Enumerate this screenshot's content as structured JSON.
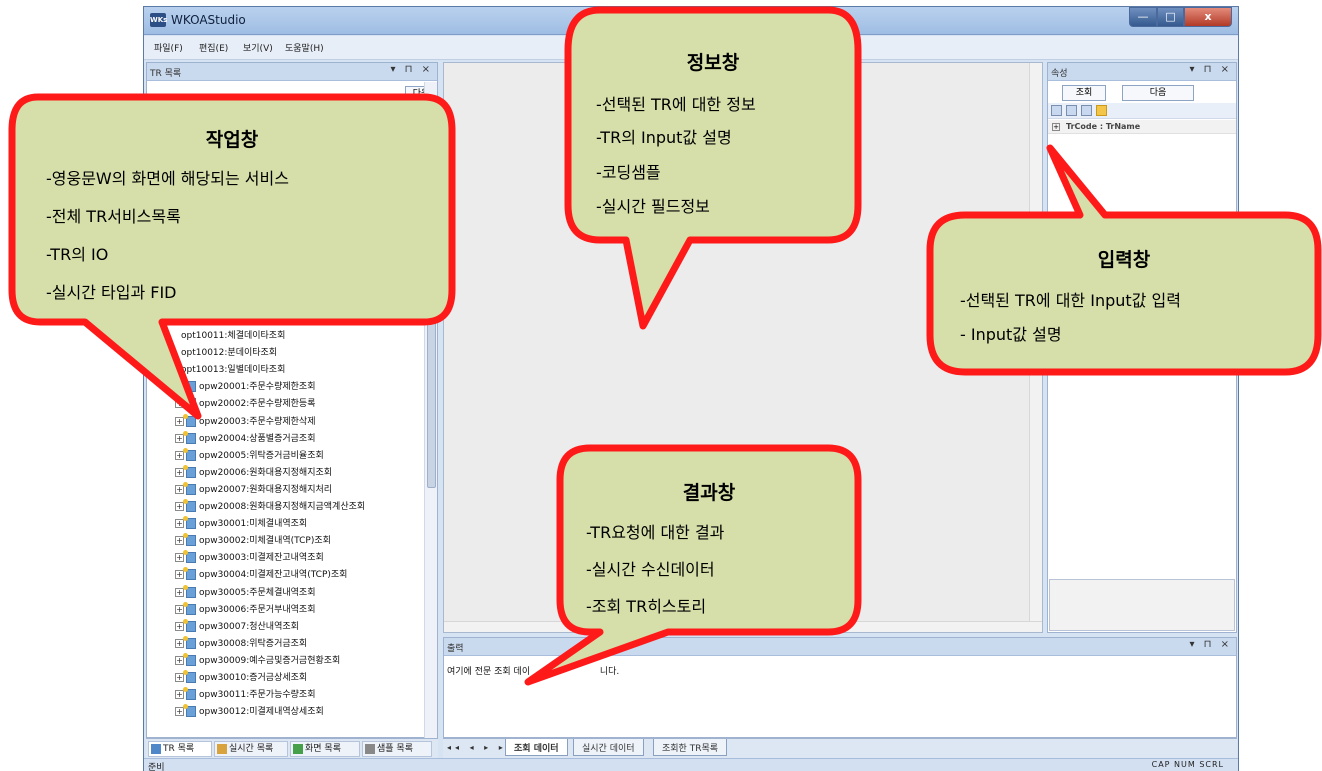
{
  "window": {
    "title": "WKOAStudio",
    "icon_text": "WKs",
    "min": "—",
    "max": "□",
    "close": "x"
  },
  "menu": {
    "items": [
      "파일(F)",
      "편집(E)",
      "보기(V)",
      "도움말(H)"
    ]
  },
  "left_pane": {
    "title": "TR 목록",
    "next_button": "다음",
    "tree_items": [
      "opt10011:체결데이타조회",
      "opt10012:분데이타조회",
      "opt10013:일별데이타조회",
      "opw20001:주문수량제한조회",
      "opw20002:주문수량제한등록",
      "opw20003:주문수량제한삭제",
      "opw20004:상품별증거금조회",
      "opw20005:위탁증거금비율조회",
      "opw20006:원화대용지정해지조회",
      "opw20007:원화대용지정해지처리",
      "opw20008:원화대용지정해지금액계산조회",
      "opw30001:미체결내역조회",
      "opw30002:미체결내역(TCP)조회",
      "opw30003:미결제잔고내역조회",
      "opw30004:미결제잔고내역(TCP)조회",
      "opw30005:주문체결내역조회",
      "opw30006:주문거부내역조회",
      "opw30007:청산내역조회",
      "opw30008:위탁증거금조회",
      "opw30009:예수금및증거금현황조회",
      "opw30010:증거금상세조회",
      "opw30011:주문가능수량조회",
      "opw30012:미결제내역상세조회"
    ],
    "tabs": [
      "TR 목록",
      "실시간 목록",
      "화면 목록",
      "샘플 목록"
    ]
  },
  "output_pane": {
    "title": "출력",
    "text": "여기에 전문 조회 데이",
    "text_tail": "니다.",
    "tabs": [
      "조회 데이터",
      "실시간 데이터",
      "조회한 TR목록"
    ]
  },
  "right_pane": {
    "title": "속성",
    "buttons": [
      "조회",
      "다음"
    ],
    "prop_label": "TrCode : TrName"
  },
  "status": {
    "left": "준비",
    "right": "CAP NUM SCRL"
  },
  "callouts": {
    "work": {
      "title": "작업창",
      "lines": [
        "-영웅문W의 화면에 해당되는 서비스",
        "-전체 TR서비스목록",
        "-TR의 IO",
        "-실시간 타입과 FID"
      ]
    },
    "info": {
      "title": "정보창",
      "lines": [
        "-선택된 TR에 대한 정보",
        "-TR의 Input값 설명",
        "-코딩샘플",
        "-실시간 필드정보"
      ]
    },
    "input": {
      "title": "입력창",
      "lines": [
        "-선택된 TR에 대한 Input값 입력",
        "- Input값 설명"
      ]
    },
    "result": {
      "title": "결과창",
      "lines": [
        "-TR요청에 대한 결과",
        "-실시간 수신데이터",
        "-조회 TR히스토리"
      ]
    }
  },
  "colors": {
    "bubble_fill": "#d6deaa",
    "bubble_stroke": "#ff1a1a"
  }
}
